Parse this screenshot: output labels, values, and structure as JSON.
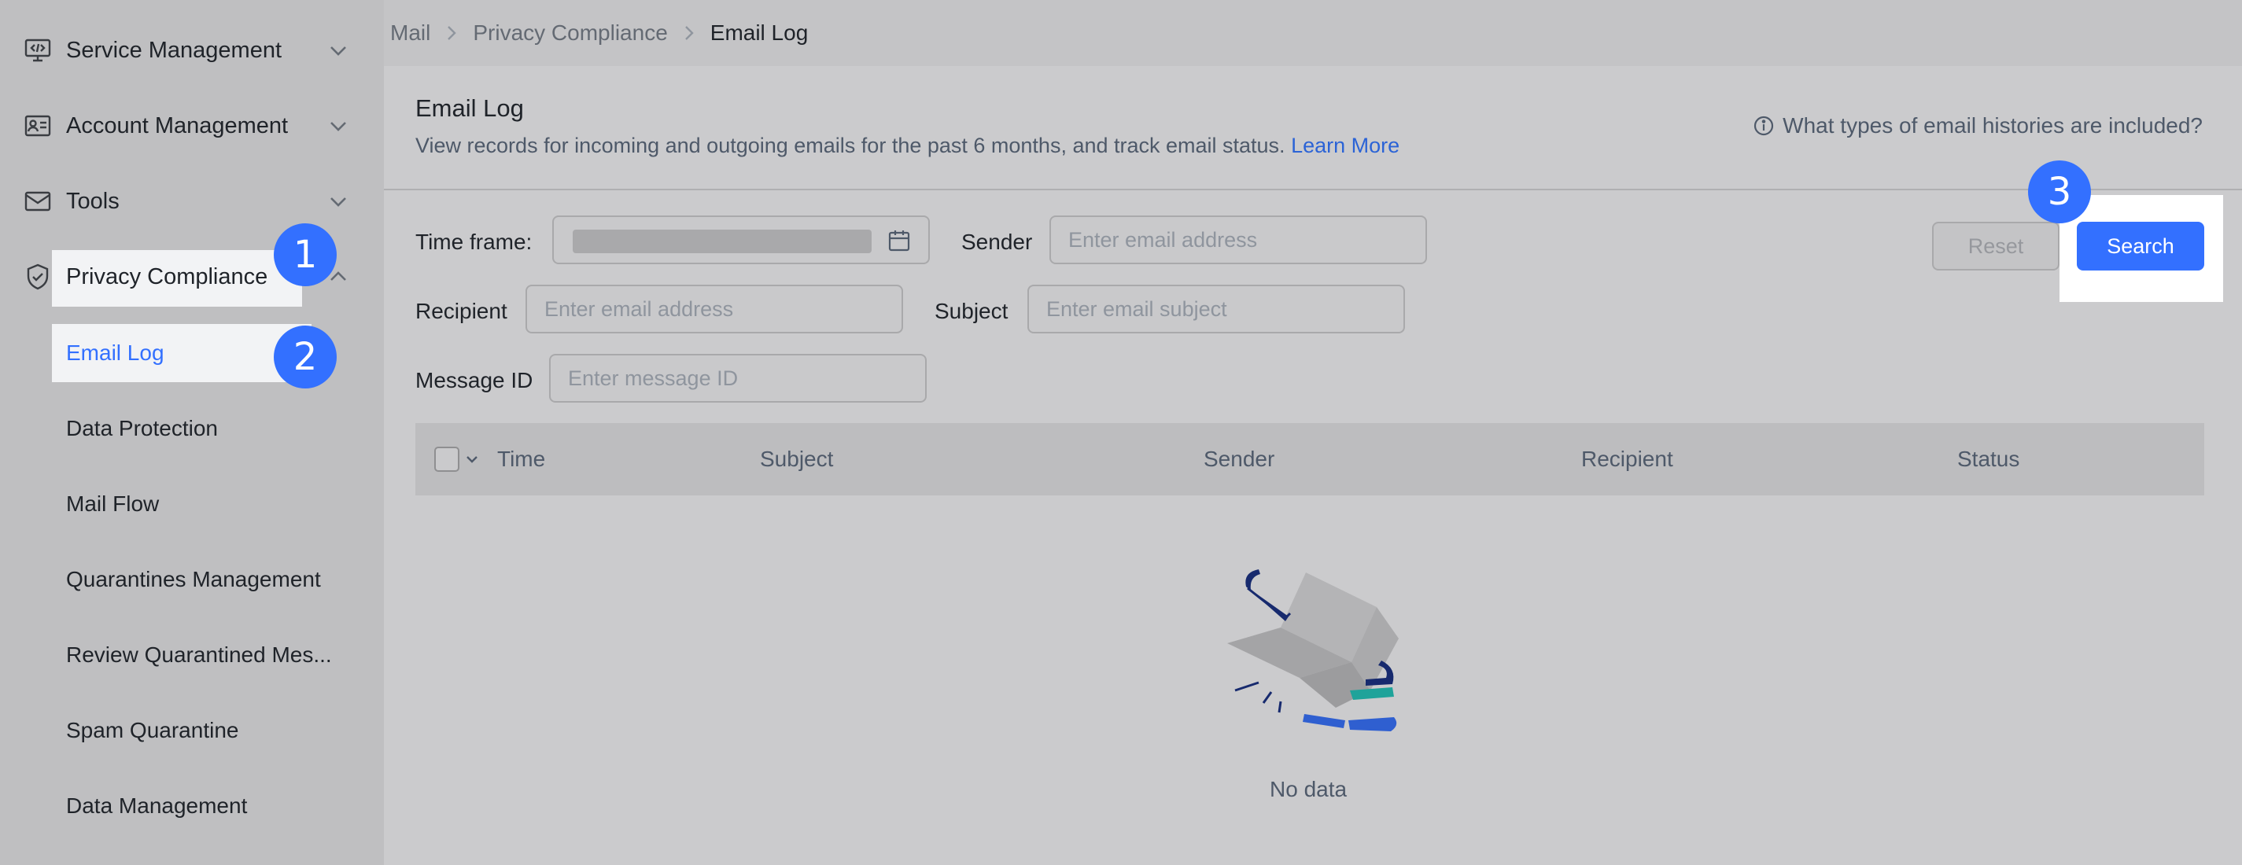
{
  "sidebar": {
    "items": [
      {
        "label": "Service Management",
        "icon": "monitor-code-icon",
        "expanded": false
      },
      {
        "label": "Account Management",
        "icon": "id-card-icon",
        "expanded": false
      },
      {
        "label": "Tools",
        "icon": "mail-icon",
        "expanded": false
      },
      {
        "label": "Privacy Compliance",
        "icon": "shield-check-icon",
        "expanded": true
      }
    ],
    "subitems": [
      {
        "label": "Email Log",
        "active": true
      },
      {
        "label": "Data Protection"
      },
      {
        "label": "Mail Flow"
      },
      {
        "label": "Quarantines Management"
      },
      {
        "label": "Review Quarantined Mes..."
      },
      {
        "label": "Spam Quarantine"
      },
      {
        "label": "Data Management"
      }
    ]
  },
  "badges": [
    "1",
    "2",
    "3"
  ],
  "breadcrumb": [
    "Mail",
    "Privacy Compliance",
    "Email Log"
  ],
  "page": {
    "title": "Email Log",
    "description": "View records for incoming and outgoing emails for the past 6 months, and track email status.",
    "learn_more": "Learn More",
    "help": "What types of email histories are included?"
  },
  "filters": {
    "time_frame_label": "Time frame:",
    "sender_label": "Sender",
    "sender_placeholder": "Enter email address",
    "recipient_label": "Recipient",
    "recipient_placeholder": "Enter email address",
    "subject_label": "Subject",
    "subject_placeholder": "Enter email subject",
    "message_id_label": "Message ID",
    "message_id_placeholder": "Enter message ID",
    "reset": "Reset",
    "search": "Search"
  },
  "table": {
    "columns": [
      "Time",
      "Subject",
      "Sender",
      "Recipient",
      "Status"
    ],
    "empty_text": "No data"
  },
  "colors": {
    "accent": "#3370ff",
    "link": "#2b63d6",
    "highlight": "#f2f3f5"
  }
}
